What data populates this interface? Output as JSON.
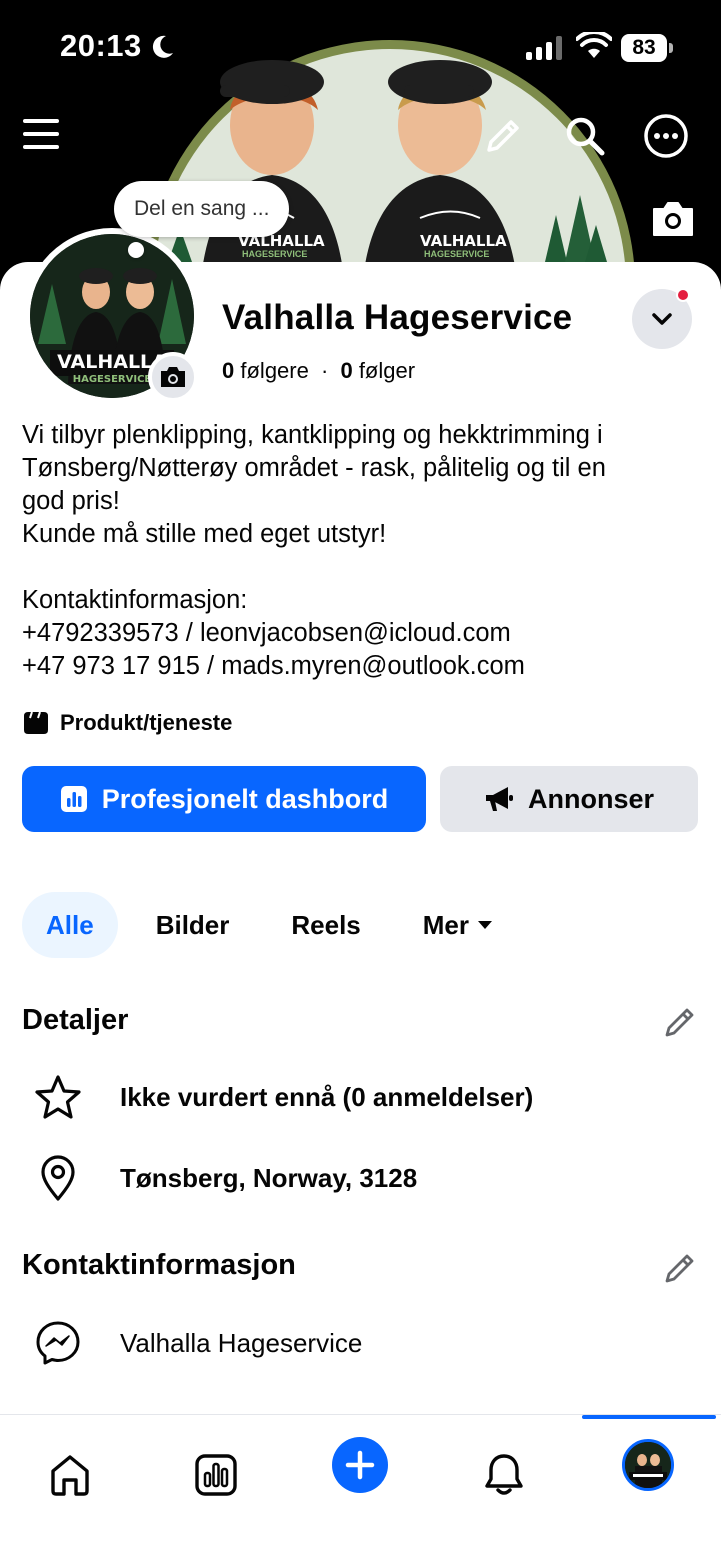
{
  "status_bar": {
    "time": "20:13",
    "battery": "83"
  },
  "cover": {
    "menu_icon": "hamburger-menu-icon",
    "edit_icon": "pencil-icon",
    "search_icon": "search-icon",
    "more_icon": "more-horizontal-icon",
    "camera_icon": "camera-icon",
    "logo_text": "VALHALLA",
    "logo_subtext": "HAGESERVICE"
  },
  "profile": {
    "song_prompt": "Del en sang ...",
    "name": "Valhalla Hageservice",
    "followers_count": "0",
    "followers_label": "følgere",
    "following_count": "0",
    "following_label": "følger",
    "separator": "·"
  },
  "bio": {
    "lines": [
      "Vi tilbyr plenklipping, kantklipping og hekktrimming i",
      "Tønsberg/Nøtterøy området - rask, pålitelig og til en",
      "god pris!",
      "Kunde må stille med eget utstyr!",
      "",
      "Kontaktinformasjon:",
      "+4792339573 / leonvjacobsen@icloud.com",
      "+47 973 17 915 / mads.myren@outlook.com"
    ]
  },
  "category": {
    "label": "Produkt/tjeneste"
  },
  "actions": {
    "primary_label": "Profesjonelt dashbord",
    "secondary_label": "Annonser"
  },
  "tabs": [
    {
      "label": "Alle",
      "active": true
    },
    {
      "label": "Bilder",
      "active": false
    },
    {
      "label": "Reels",
      "active": false
    },
    {
      "label": "Mer",
      "active": false
    }
  ],
  "details": {
    "title": "Detaljer",
    "rating": "Ikke vurdert ennå (0 anmeldelser)",
    "location": "Tønsberg, Norway, 3128"
  },
  "contact": {
    "title": "Kontaktinformasjon",
    "messenger": "Valhalla Hageservice"
  },
  "bottom_nav": {
    "items": [
      "home-icon",
      "dashboard-icon",
      "create-plus-icon",
      "notifications-bell-icon",
      "profile-avatar"
    ],
    "active": "profile-avatar"
  },
  "colors": {
    "accent": "#0866ff",
    "button_gray": "#e4e6eb",
    "active_tab_bg": "#ebf5ff",
    "notification_dot": "#e41e3f"
  }
}
